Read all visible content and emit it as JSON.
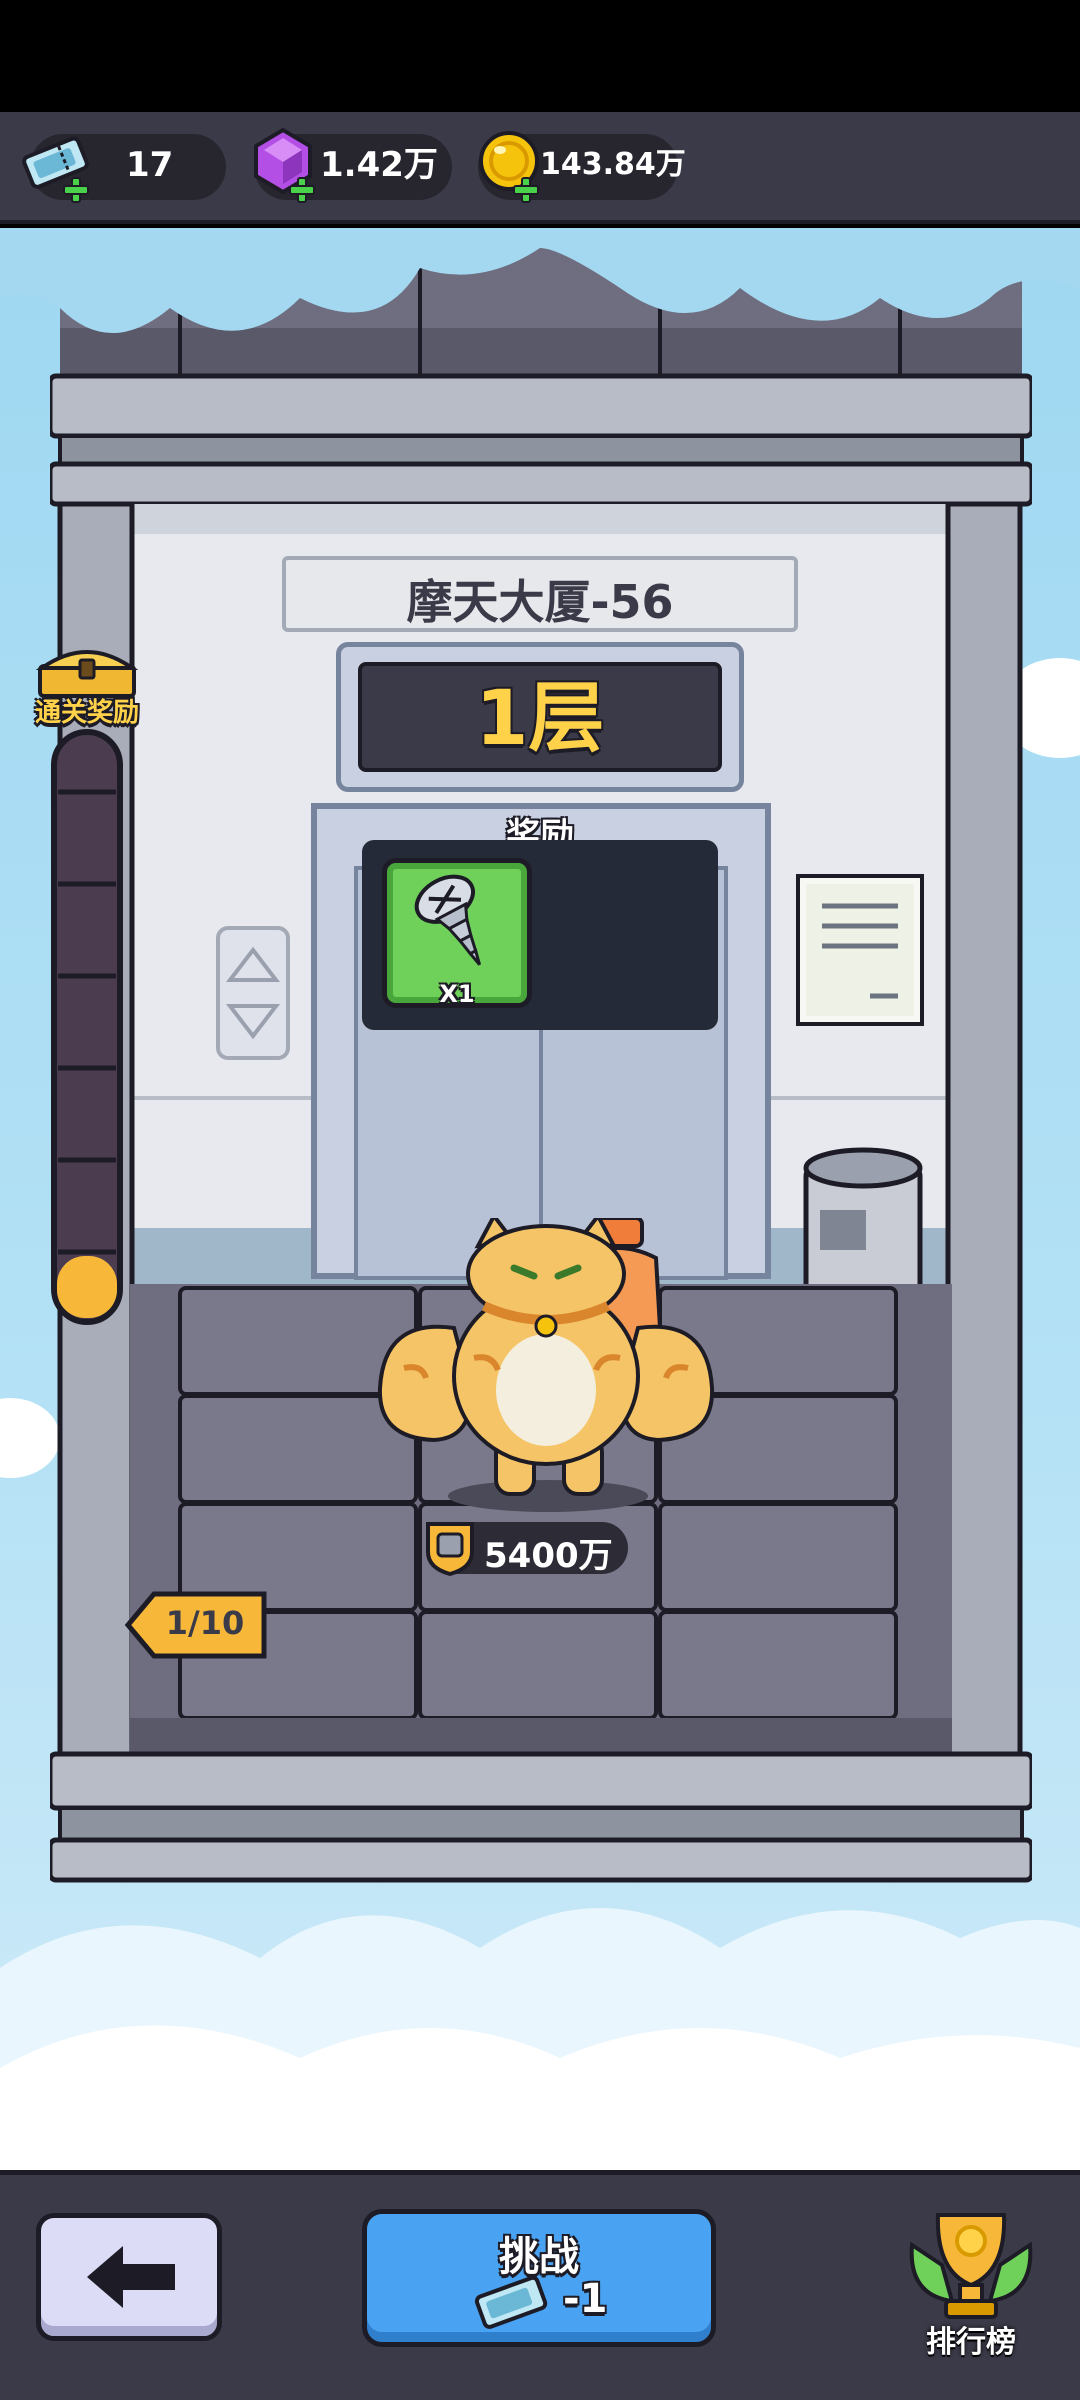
{
  "resources": {
    "tickets": "17",
    "gems": "1.42万",
    "coins": "143.84万"
  },
  "building": {
    "title": "摩天大厦-56",
    "floor": "1层"
  },
  "reward": {
    "label": "奖励",
    "item_count": "X1",
    "item_icon": "screw-icon"
  },
  "clear_reward": {
    "label": "通关奖励"
  },
  "progress": {
    "text": "1/10",
    "current": 1,
    "total": 10
  },
  "enemy": {
    "power": "5400万"
  },
  "bottom": {
    "challenge_label": "挑战",
    "challenge_cost": "-1",
    "rank_label": "排行榜"
  },
  "colors": {
    "accent_yellow": "#f7b83a",
    "button_blue": "#4aa3f2",
    "gem_purple": "#b44fe6",
    "coin_gold": "#f6c30c"
  }
}
